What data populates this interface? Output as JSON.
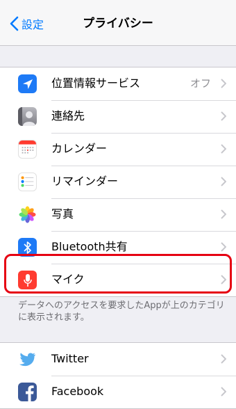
{
  "navbar": {
    "back_label": "設定",
    "title": "プライバシー"
  },
  "group1": [
    {
      "icon": "location-arrow-icon",
      "label": "位置情報サービス",
      "value": "オフ",
      "color": "#1e7af6"
    },
    {
      "icon": "contacts-icon",
      "label": "連絡先",
      "value": "",
      "color": "#8e8e93"
    },
    {
      "icon": "calendar-icon",
      "label": "カレンダー",
      "value": "",
      "color": "#ff3b30"
    },
    {
      "icon": "reminders-icon",
      "label": "リマインダー",
      "value": "",
      "color": "#ffffff"
    },
    {
      "icon": "photos-icon",
      "label": "写真",
      "value": "",
      "color": "#ffffff"
    },
    {
      "icon": "bluetooth-icon",
      "label": "Bluetooth共有",
      "value": "",
      "color": "#1e7af6"
    },
    {
      "icon": "microphone-icon",
      "label": "マイク",
      "value": "",
      "color": "#ff3b30"
    }
  ],
  "footer_note": "データへのアクセスを要求したAppが上のカテゴリに表示されます。",
  "group2": [
    {
      "icon": "twitter-icon",
      "label": "Twitter",
      "value": "",
      "color": "#55acee"
    },
    {
      "icon": "facebook-icon",
      "label": "Facebook",
      "value": "",
      "color": "#3b5998"
    }
  ],
  "highlight_color": "#e60012"
}
